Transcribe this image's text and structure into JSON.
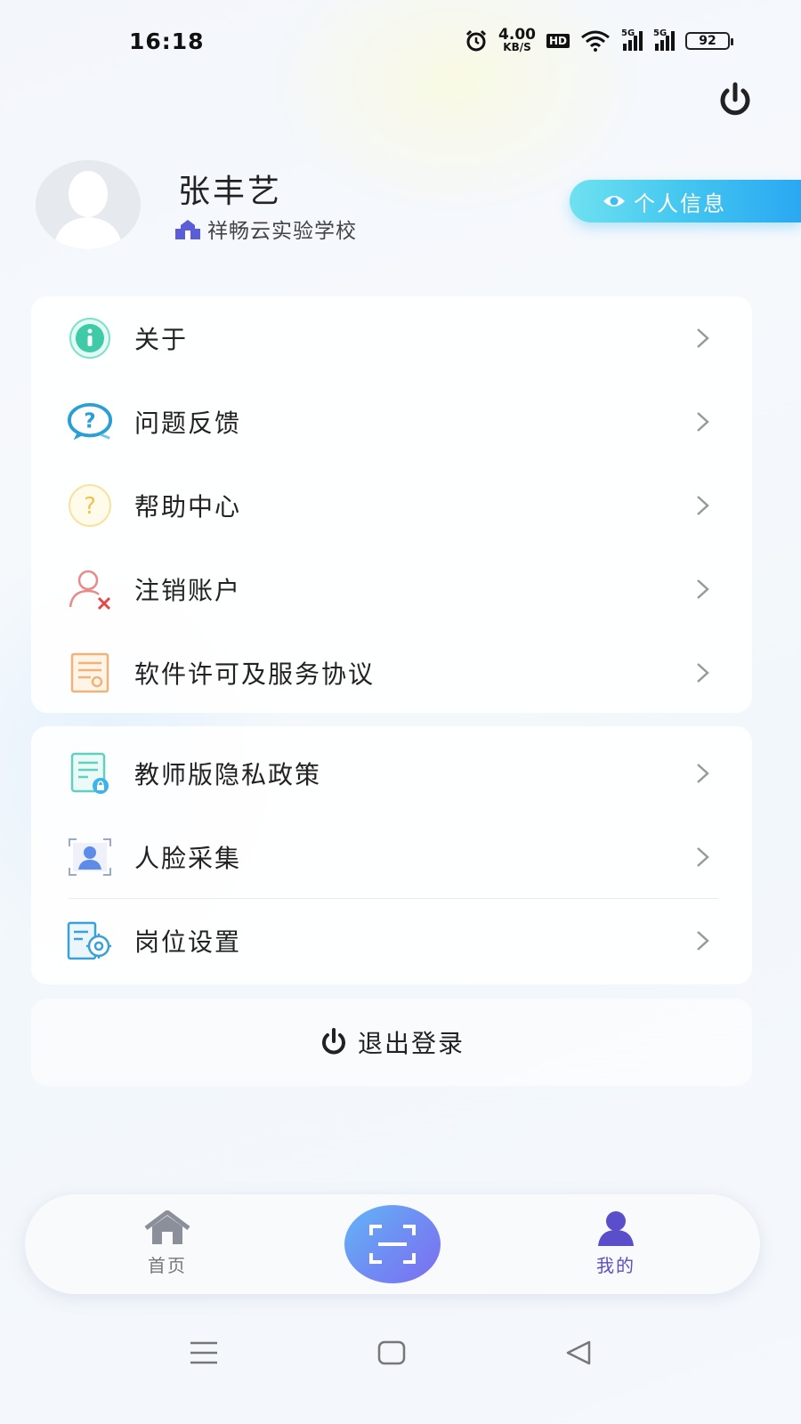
{
  "status_bar": {
    "time": "16:18",
    "net_speed": "4.00",
    "net_unit": "KB/S",
    "hd_label": "HD",
    "sim1_tag": "5G",
    "sim2_tag": "5G",
    "battery": "92"
  },
  "profile": {
    "name": "张丰艺",
    "school": "祥畅云实验学校",
    "info_button": "个人信息"
  },
  "menu_group_1": [
    {
      "label": "关于",
      "icon": "info-icon"
    },
    {
      "label": "问题反馈",
      "icon": "feedback-icon"
    },
    {
      "label": "帮助中心",
      "icon": "help-icon"
    },
    {
      "label": "注销账户",
      "icon": "remove-user-icon"
    },
    {
      "label": "软件许可及服务协议",
      "icon": "license-document-icon"
    }
  ],
  "menu_group_2": [
    {
      "label": "教师版隐私政策",
      "icon": "privacy-document-icon"
    },
    {
      "label": "人脸采集",
      "icon": "face-capture-icon"
    },
    {
      "label": "岗位设置",
      "icon": "position-settings-icon"
    }
  ],
  "logout": {
    "label": "退出登录"
  },
  "bottom_nav": {
    "home": "首页",
    "mine": "我的"
  },
  "colors": {
    "accent": "#5b4ecb",
    "info_button_start": "#6fe1f0",
    "info_button_end": "#2aa8f2",
    "scan_start": "#62b6f7",
    "scan_end": "#7d6cf0"
  }
}
